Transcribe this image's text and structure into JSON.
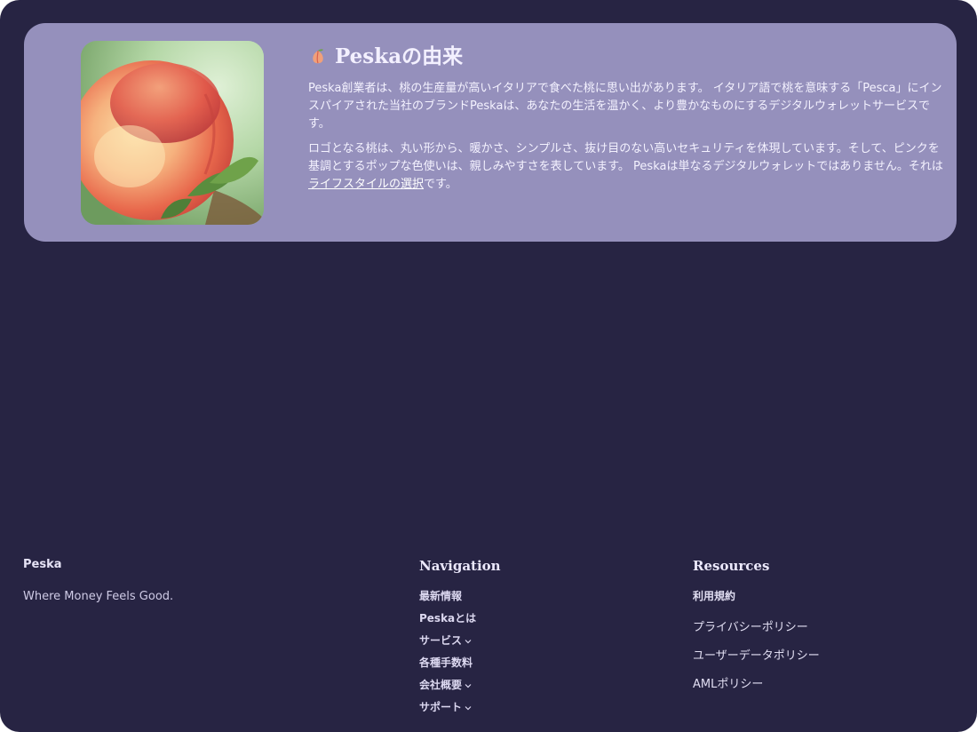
{
  "origin": {
    "title": "Peskaの由来",
    "paragraph1": "Peska創業者は、桃の生産量が高いイタリアで食べた桃に思い出があります。 イタリア語で桃を意味する「Pesca」にインスパイアされた当社のブランドPeskaは、あなたの生活を温かく、より豊かなものにするデジタルウォレットサービスです。",
    "paragraph2_before": "ロゴとなる桃は、丸い形から、暖かさ、シンプルさ、抜け目のない高いセキュリティを体現しています。そして、ピンクを基調とするポップな色使いは、親しみやすさを表しています。 Peskaは単なるデジタルウォレットではありません。それは",
    "paragraph2_link": "ライフスタイルの選択",
    "paragraph2_after": "です。",
    "image_icon": "peach-photo"
  },
  "footer": {
    "brand": "Peska",
    "tagline": "Where Money Feels Good.",
    "navigation": {
      "heading": "Navigation",
      "items": [
        {
          "label": "最新情報",
          "has_dropdown": false
        },
        {
          "label": "Peskaとは",
          "has_dropdown": false
        },
        {
          "label": "サービス",
          "has_dropdown": true
        },
        {
          "label": "各種手数料",
          "has_dropdown": false
        },
        {
          "label": "会社概要",
          "has_dropdown": true
        },
        {
          "label": "サポート",
          "has_dropdown": true
        }
      ]
    },
    "resources": {
      "heading": "Resources",
      "items": [
        {
          "label": "利用規約"
        },
        {
          "label": "プライバシーポリシー"
        },
        {
          "label": "ユーザーデータポリシー"
        },
        {
          "label": "AMLポリシー"
        }
      ]
    }
  },
  "colors": {
    "background": "#272443",
    "card": "#9590bc",
    "accent_peach": "#f0a07a"
  }
}
